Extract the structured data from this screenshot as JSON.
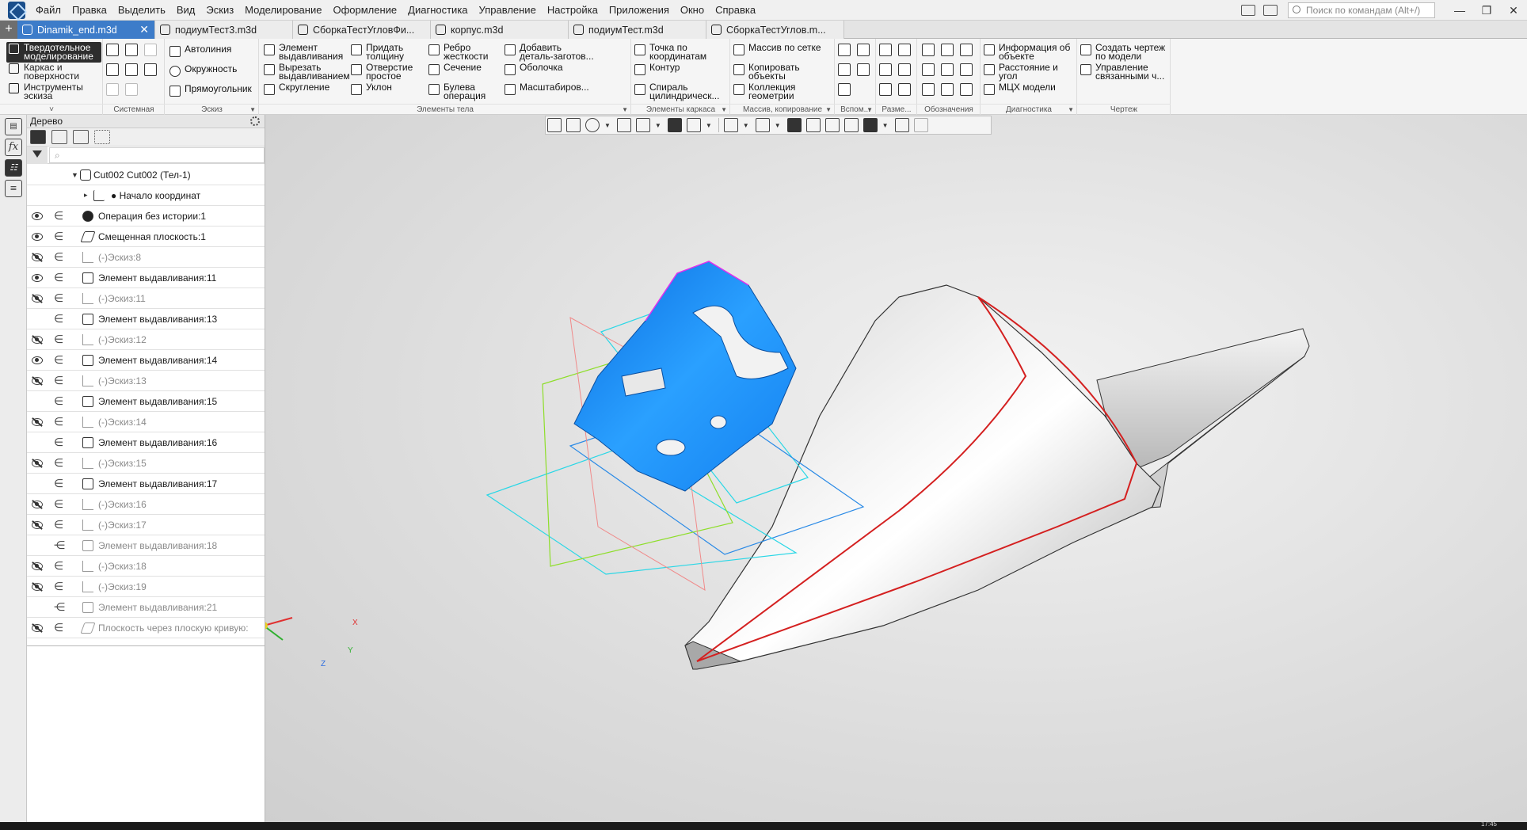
{
  "menubar": {
    "items": [
      "Файл",
      "Правка",
      "Выделить",
      "Вид",
      "Эскиз",
      "Моделирование",
      "Оформление",
      "Диагностика",
      "Управление",
      "Настройка",
      "Приложения",
      "Окно",
      "Справка"
    ],
    "search_placeholder": "Поиск по командам (Alt+/)",
    "win_controls": [
      "—",
      "❐",
      "✕"
    ]
  },
  "tabs": [
    {
      "label": "Dinamik_end.m3d",
      "active": true,
      "close": "✕"
    },
    {
      "label": "подиумТест3.m3d"
    },
    {
      "label": "СборкаТестУгловФи..."
    },
    {
      "label": "корпус.m3d"
    },
    {
      "label": "подиумТест.m3d"
    },
    {
      "label": "СборкаТестУглов.m..."
    }
  ],
  "ribbon": {
    "modes": [
      {
        "label": "Твердотельное\nмоделирование",
        "active": true
      },
      {
        "label": "Каркас и\nповерхности"
      },
      {
        "label": "Инструменты\nэскиза"
      }
    ],
    "groups": {
      "system": "Системная",
      "sketch": "Эскиз",
      "body": "Элементы тела",
      "frame": "Элементы каркаса",
      "array": "Массив, копирование",
      "aux": "Вспом...",
      "dims": "Разме...",
      "marks": "Обозначения",
      "diag": "Диагностика",
      "drawing": "Чертеж"
    },
    "sketch_buttons": [
      "Автолиния",
      "Окружность",
      "Прямоугольник"
    ],
    "body_col1": [
      "Элемент\nвыдавливания",
      "Вырезать\nвыдавливанием",
      "Скругление"
    ],
    "body_col2": [
      "Придать\nтолщину",
      "Отверстие\nпростое",
      "Уклон"
    ],
    "body_col3": [
      "Ребро\nжесткости",
      "Сечение",
      "Булева\nоперация"
    ],
    "body_col4": [
      "Добавить\nдеталь-заготов...",
      "Оболочка",
      "Масштабиров..."
    ],
    "frame_buttons": [
      "Точка по\nкоординатам",
      "Контур",
      "Спираль\nцилиндрическ..."
    ],
    "array_buttons": [
      "Массив по сетке",
      "Копировать\nобъекты",
      "Коллекция\nгеометрии"
    ],
    "diag_buttons": [
      "Информация об\nобъекте",
      "Расстояние и\nугол",
      "МЦХ модели"
    ],
    "drawing_buttons": [
      "Создать чертеж\nпо модели",
      "Управление\nсвязанными ч..."
    ]
  },
  "tree": {
    "title": "Дерево",
    "search_glyph": "⌕",
    "root": "Cut002 Cut002 (Тел-1)",
    "rows": [
      {
        "label": "● Начало координат",
        "eye": "none",
        "elem": false,
        "type": "origin",
        "dim": false,
        "expand": true
      },
      {
        "label": "Операция без истории:1",
        "eye": "visible",
        "elem": true,
        "type": "solid",
        "dim": false
      },
      {
        "label": "Смещенная плоскость:1",
        "eye": "visible",
        "elem": true,
        "type": "plane",
        "dim": false
      },
      {
        "label": "(-)Эскиз:8",
        "eye": "hidden",
        "elem": true,
        "type": "sketch",
        "dim": true
      },
      {
        "label": "Элемент выдавливания:11",
        "eye": "visible",
        "elem": true,
        "type": "extrude",
        "dim": false
      },
      {
        "label": "(-)Эскиз:11",
        "eye": "hidden",
        "elem": true,
        "type": "sketch",
        "dim": true
      },
      {
        "label": "Элемент выдавливания:13",
        "eye": "none",
        "elem": true,
        "type": "extrude",
        "dim": false
      },
      {
        "label": "(-)Эскиз:12",
        "eye": "hidden",
        "elem": true,
        "type": "sketch",
        "dim": true
      },
      {
        "label": "Элемент выдавливания:14",
        "eye": "visible",
        "elem": true,
        "type": "extrude",
        "dim": false
      },
      {
        "label": "(-)Эскиз:13",
        "eye": "hidden",
        "elem": true,
        "type": "sketch",
        "dim": true
      },
      {
        "label": "Элемент выдавливания:15",
        "eye": "none",
        "elem": true,
        "type": "extrude",
        "dim": false
      },
      {
        "label": "(-)Эскиз:14",
        "eye": "hidden",
        "elem": true,
        "type": "sketch",
        "dim": true
      },
      {
        "label": "Элемент выдавливания:16",
        "eye": "none",
        "elem": true,
        "type": "extrude",
        "dim": false
      },
      {
        "label": "(-)Эскиз:15",
        "eye": "hidden",
        "elem": true,
        "type": "sketch",
        "dim": true
      },
      {
        "label": "Элемент выдавливания:17",
        "eye": "none",
        "elem": true,
        "type": "extrude",
        "dim": false
      },
      {
        "label": "(-)Эскиз:16",
        "eye": "hidden",
        "elem": true,
        "type": "sketch",
        "dim": true
      },
      {
        "label": "(-)Эскиз:17",
        "eye": "hidden",
        "elem": true,
        "type": "sketch",
        "dim": true
      },
      {
        "label": "Элемент выдавливания:18",
        "eye": "none",
        "elem": "struck",
        "type": "extrude",
        "dim": true
      },
      {
        "label": "(-)Эскиз:18",
        "eye": "hidden",
        "elem": true,
        "type": "sketch",
        "dim": true
      },
      {
        "label": "(-)Эскиз:19",
        "eye": "hidden",
        "elem": true,
        "type": "sketch",
        "dim": true
      },
      {
        "label": "Элемент выдавливания:21",
        "eye": "none",
        "elem": "struck",
        "type": "extrude",
        "dim": true
      },
      {
        "label": "Плоскость через плоскую кривую:",
        "eye": "hidden",
        "elem": true,
        "type": "plane",
        "dim": true
      }
    ]
  },
  "viewport": {
    "axes": {
      "x": "X",
      "y": "Y",
      "z": "Z"
    },
    "colors": {
      "body_blue": "#1e90ff",
      "edge_red": "#d42020",
      "plane_cyan": "#29d7e6",
      "plane_green": "#8ede2a",
      "plane_red": "#f08a8a",
      "plane_magenta": "#e02ef0"
    }
  },
  "statusbar": {
    "clock": "17:45"
  },
  "colors": {
    "accent": "#3d7cc9",
    "active_mode": "#2d2d2d"
  }
}
